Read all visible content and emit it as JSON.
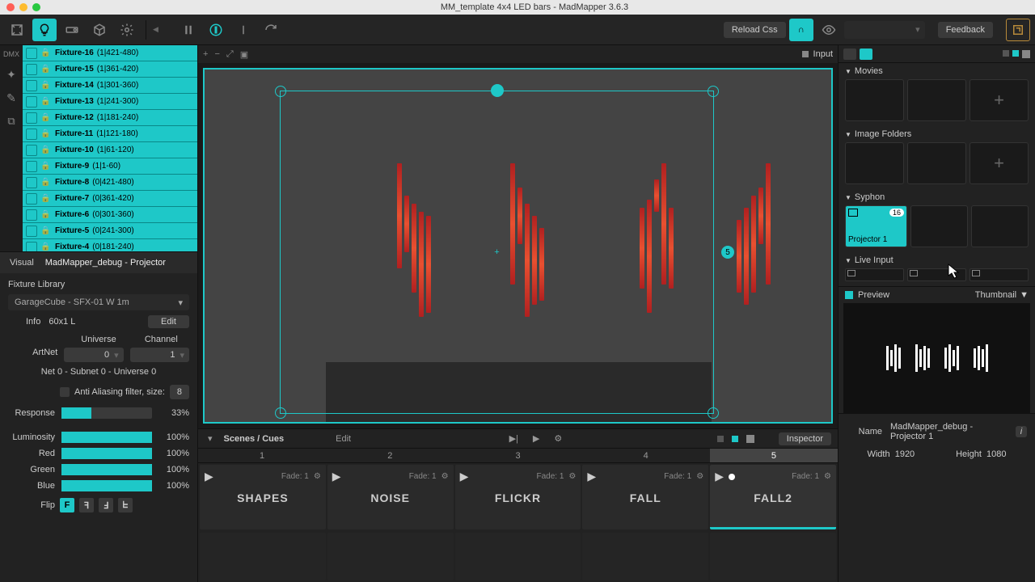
{
  "window": {
    "title": "MM_template 4x4 LED bars - MadMapper 3.6.3"
  },
  "toolbar": {
    "reload": "Reload Css",
    "feedback": "Feedback"
  },
  "left": {
    "dmx_label": "DMX",
    "fixtures": [
      {
        "name": "Fixture-16",
        "range": "(1|421-480)"
      },
      {
        "name": "Fixture-15",
        "range": "(1|361-420)"
      },
      {
        "name": "Fixture-14",
        "range": "(1|301-360)"
      },
      {
        "name": "Fixture-13",
        "range": "(1|241-300)"
      },
      {
        "name": "Fixture-12",
        "range": "(1|181-240)"
      },
      {
        "name": "Fixture-11",
        "range": "(1|121-180)"
      },
      {
        "name": "Fixture-10",
        "range": "(1|61-120)"
      },
      {
        "name": "Fixture-9",
        "range": "(1|1-60)"
      },
      {
        "name": "Fixture-8",
        "range": "(0|421-480)"
      },
      {
        "name": "Fixture-7",
        "range": "(0|361-420)"
      },
      {
        "name": "Fixture-6",
        "range": "(0|301-360)"
      },
      {
        "name": "Fixture-5",
        "range": "(0|241-300)"
      },
      {
        "name": "Fixture-4",
        "range": "(0|181-240)"
      }
    ],
    "visual": "Visual",
    "visual_name": "MadMapper_debug - Projector",
    "library_title": "Fixture Library",
    "library_value": "GarageCube - SFX-01 W 1m",
    "info_label": "Info",
    "info_value": "60x1 L",
    "edit": "Edit",
    "universe_label": "Universe",
    "channel_label": "Channel",
    "protocol_label": "ArtNet",
    "universe_value": "0",
    "channel_value": "1",
    "net_line": "Net 0 - Subnet 0 - Universe 0",
    "aa_label": "Anti Aliasing filter, size:",
    "aa_value": "8",
    "sliders": {
      "response": {
        "label": "Response",
        "value": "33%",
        "fill": 33
      },
      "luminosity": {
        "label": "Luminosity",
        "value": "100%",
        "fill": 100
      },
      "red": {
        "label": "Red",
        "value": "100%",
        "fill": 100
      },
      "green": {
        "label": "Green",
        "value": "100%",
        "fill": 100
      },
      "blue": {
        "label": "Blue",
        "value": "100%",
        "fill": 100
      }
    },
    "flip_label": "Flip"
  },
  "canvas": {
    "input_label": "Input",
    "badge": "5"
  },
  "scenes": {
    "title": "Scenes / Cues",
    "edit": "Edit",
    "inspector": "Inspector",
    "numbers": [
      "1",
      "2",
      "3",
      "4",
      "5"
    ],
    "active_index": 4,
    "cards": [
      {
        "fade": "Fade: 1",
        "name": "SHAPES"
      },
      {
        "fade": "Fade: 1",
        "name": "NOISE"
      },
      {
        "fade": "Fade: 1",
        "name": "FLICKR"
      },
      {
        "fade": "Fade: 1",
        "name": "FALL"
      },
      {
        "fade": "Fade: 1",
        "name": "FALL2"
      }
    ]
  },
  "right": {
    "movies": "Movies",
    "image_folders": "Image Folders",
    "syphon": "Syphon",
    "syphon_item": "Projector 1",
    "syphon_badge": "16",
    "live_input": "Live Input",
    "preview": "Preview",
    "preview_mode": "Thumbnail",
    "name_label": "Name",
    "name_value": "MadMapper_debug - Projector 1",
    "width_label": "Width",
    "width_value": "1920",
    "height_label": "Height",
    "height_value": "1080"
  }
}
